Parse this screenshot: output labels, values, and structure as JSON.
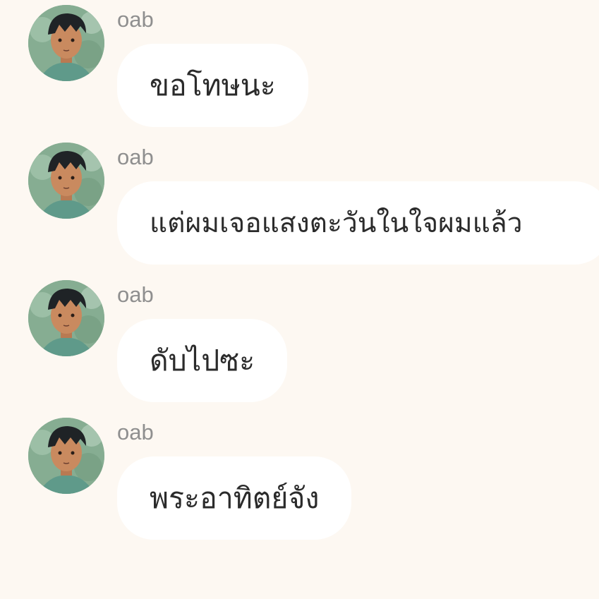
{
  "chat": {
    "messages": [
      {
        "sender": "oab",
        "avatar_icon": "avatar-icon",
        "text": "ขอโทษนะ"
      },
      {
        "sender": "oab",
        "avatar_icon": "avatar-icon",
        "text": "แต่ผมเจอแสงตะวันในใจผมแล้ว"
      },
      {
        "sender": "oab",
        "avatar_icon": "avatar-icon",
        "text": "ดับไปซะ"
      },
      {
        "sender": "oab",
        "avatar_icon": "avatar-icon",
        "text": "พระอาทิตย์จัง"
      }
    ]
  },
  "colors": {
    "background": "#fdf8f2",
    "bubble": "#ffffff",
    "sender_text": "#8f8f8f",
    "message_text": "#2b2b2b"
  }
}
